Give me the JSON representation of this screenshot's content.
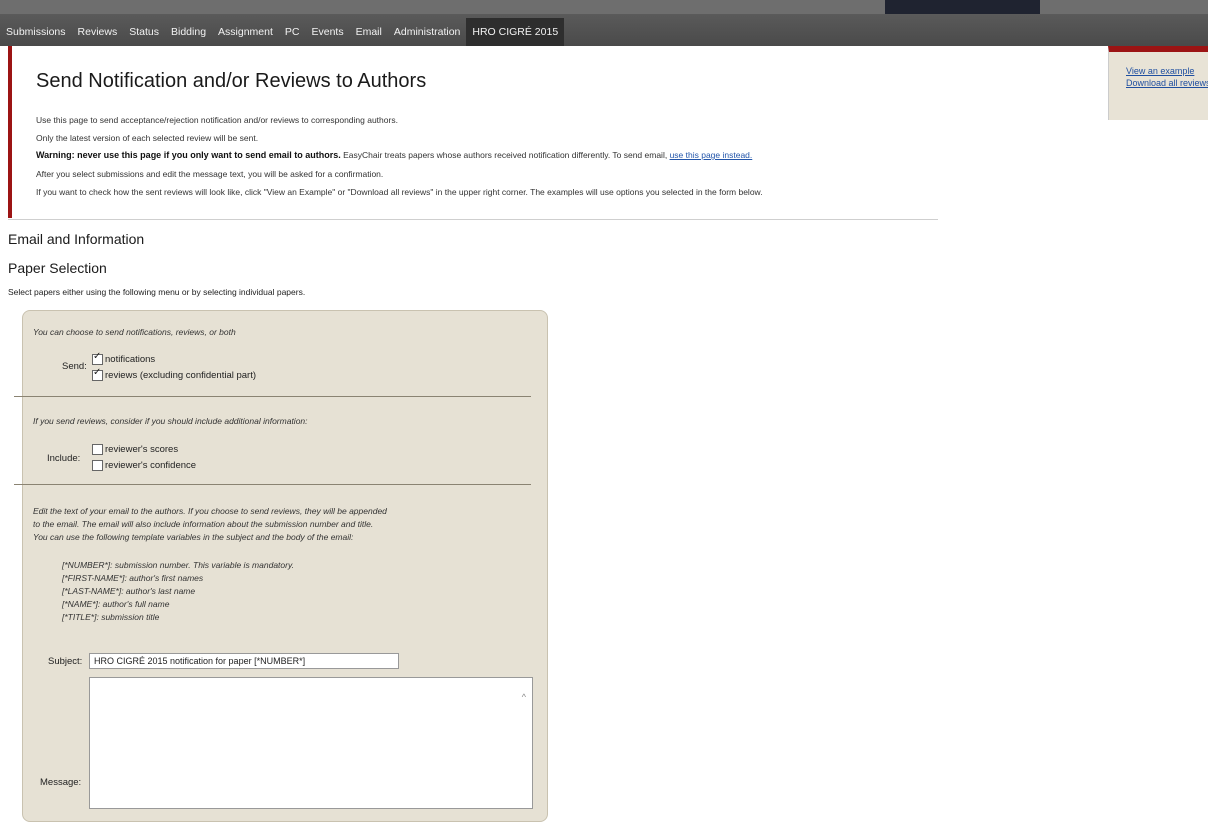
{
  "nav": {
    "items": [
      "Submissions",
      "Reviews",
      "Status",
      "Bidding",
      "Assignment",
      "PC",
      "Events",
      "Email",
      "Administration",
      "HRO CIGRÉ 2015"
    ]
  },
  "header": {
    "title": "Send Notification and/or Reviews to Authors",
    "line1": "Use this page to send acceptance/rejection notification and/or reviews to corresponding authors.",
    "line2": "Only the latest version of each selected review will be sent.",
    "warning_bold": "Warning: never use this page if you only want to send email to authors.",
    "warning_rest": " EasyChair treats papers whose authors received notification differently. To send email, ",
    "warning_link": "use this page instead.",
    "line4": "After you select submissions and edit the message text, you will be asked for a confirmation.",
    "line5": "If you want to check how the sent reviews will look like, click \"View an Example\" or \"Download all reviews\" in the upper right corner. The examples will use options you selected in the form below."
  },
  "right_links": {
    "view_example": "View an example",
    "download_reviews": "Download all reviews"
  },
  "sections": {
    "email_info": "Email and Information",
    "paper_selection": "Paper Selection",
    "paper_selection_note": "Select papers either using the following menu or by selecting individual papers."
  },
  "form": {
    "choose_note": "You can choose to send notifications, reviews, or both",
    "send_label": "Send:",
    "send_options": [
      {
        "label": "notifications",
        "checked": true
      },
      {
        "label": "reviews (excluding confidential part)",
        "checked": true
      }
    ],
    "include_note": "If you send reviews, consider if you should include additional information:",
    "include_label": "Include:",
    "include_options": [
      {
        "label": "reviewer's scores",
        "checked": false
      },
      {
        "label": "reviewer's confidence",
        "checked": false
      }
    ],
    "edit_note_1": "Edit the text of your email to the authors. If you choose to send reviews, they will be appended",
    "edit_note_2": "to the email. The email will also include information about the submission number and title.",
    "edit_note_3": "You can use the following template variables in the subject and the body of the email:",
    "variables": [
      "[*NUMBER*]: submission number. This variable is mandatory.",
      "[*FIRST-NAME*]: author's first names",
      "[*LAST-NAME*]: author's last name",
      "[*NAME*]: author's full name",
      "[*TITLE*]: submission title"
    ],
    "subject_label": "Subject:",
    "subject_value": "HRO CIGRÉ 2015 notification for paper [*NUMBER*]",
    "message_label": "Message:"
  }
}
